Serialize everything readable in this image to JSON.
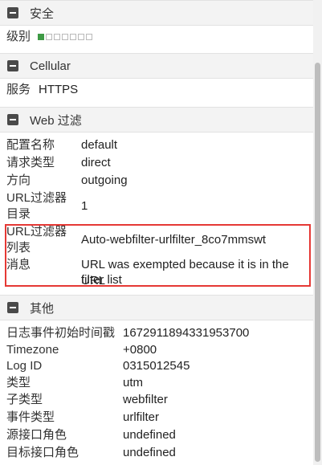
{
  "sections": {
    "security": {
      "title": "安全",
      "level_label": "级别",
      "level": {
        "filled": 1,
        "total": 7,
        "color": "#3e9a45"
      }
    },
    "cellular": {
      "title": "Cellular",
      "service_label": "服务",
      "service_value": "HTTPS"
    },
    "web_filter": {
      "title": "Web 过滤",
      "rows": [
        {
          "label": "配置名称",
          "value": "default"
        },
        {
          "label": "请求类型",
          "value": "direct"
        },
        {
          "label": "方向",
          "value": "outgoing"
        },
        {
          "label_line1": "URL过滤器",
          "label_line2": "目录",
          "value": "1"
        },
        {
          "label_line1": "URL过滤器",
          "label_line2": "列表",
          "value": "Auto-webfilter-urlfilter_8co7mmswt"
        },
        {
          "label": "消息",
          "value_line1": "URL was exempted because it is in the URL",
          "value_line2": "filter list"
        }
      ]
    },
    "other": {
      "title": "其他",
      "rows": [
        {
          "label": "日志事件初始时间戳",
          "value": "1672911894331953700"
        },
        {
          "label": "Timezone",
          "value": "+0800"
        },
        {
          "label": "Log ID",
          "value": "0315012545"
        },
        {
          "label": "类型",
          "value": "utm"
        },
        {
          "label": "子类型",
          "value": "webfilter"
        },
        {
          "label": "事件类型",
          "value": "urlfilter"
        },
        {
          "label": "源接口角色",
          "value": "undefined"
        },
        {
          "label": "目标接口角色",
          "value": "undefined"
        }
      ]
    }
  },
  "highlight_color": "#e53935"
}
